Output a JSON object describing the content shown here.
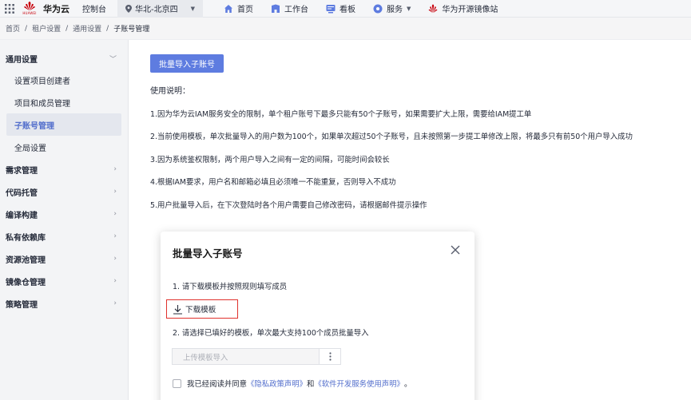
{
  "topbar": {
    "brand": "华为云",
    "logo_small": "HUAWEI",
    "console": "控制台",
    "region": "华北-北京四",
    "nav": [
      {
        "label": "首页"
      },
      {
        "label": "工作台"
      },
      {
        "label": "看板"
      },
      {
        "label": "服务"
      },
      {
        "label": "华为开源镜像站"
      }
    ]
  },
  "breadcrumb": {
    "items": [
      "首页",
      "租户设置",
      "通用设置",
      "子账号管理"
    ],
    "separator": "/"
  },
  "sidebar": {
    "groups": [
      {
        "label": "通用设置",
        "expanded": true,
        "items": [
          "设置项目创建者",
          "项目和成员管理",
          "子账号管理",
          "全局设置"
        ],
        "active": "子账号管理"
      },
      {
        "label": "需求管理"
      },
      {
        "label": "代码托管"
      },
      {
        "label": "编译构建"
      },
      {
        "label": "私有依赖库"
      },
      {
        "label": "资源池管理"
      },
      {
        "label": "镜像仓管理"
      },
      {
        "label": "策略管理"
      }
    ]
  },
  "main": {
    "import_button": "批量导入子账号",
    "usage_title": "使用说明：",
    "usage_lines": [
      "1.因为华为云IAM服务安全的限制，单个租户账号下最多只能有50个子账号，如果需要扩大上限，需要给IAM提工单",
      "2.当前使用模板，单次批量导入的用户数为100个，如果单次超过50个子账号，且未按照第一步提工单修改上限，将最多只有前50个用户导入成功",
      "3.因为系统鉴权限制，两个用户导入之间有一定的间隔，可能时间会较长",
      "4.根据IAM要求，用户名和邮箱必填且必须唯一不能重复，否则导入不成功",
      "5.用户批量导入后，在下次登陆时各个用户需要自己修改密码，请根据邮件提示操作"
    ]
  },
  "dialog": {
    "title": "批量导入子账号",
    "step1": "1. 请下载模板并按照规则填写成员",
    "download_label": "下载模板",
    "step2": "2. 请选择已填好的模板，单次最大支持100个成员批量导入",
    "upload_placeholder": "上传模板导入",
    "agree_prefix": "我已经阅读并同意",
    "privacy_link": "《隐私政策声明》",
    "agree_and": "和",
    "service_link": "《软件开发服务使用声明》",
    "agree_suffix": "。"
  },
  "colors": {
    "primary": "#5e7ce0",
    "link": "#526ecc",
    "highlight_border": "#e0312c",
    "brand_red": "#c7000b"
  }
}
